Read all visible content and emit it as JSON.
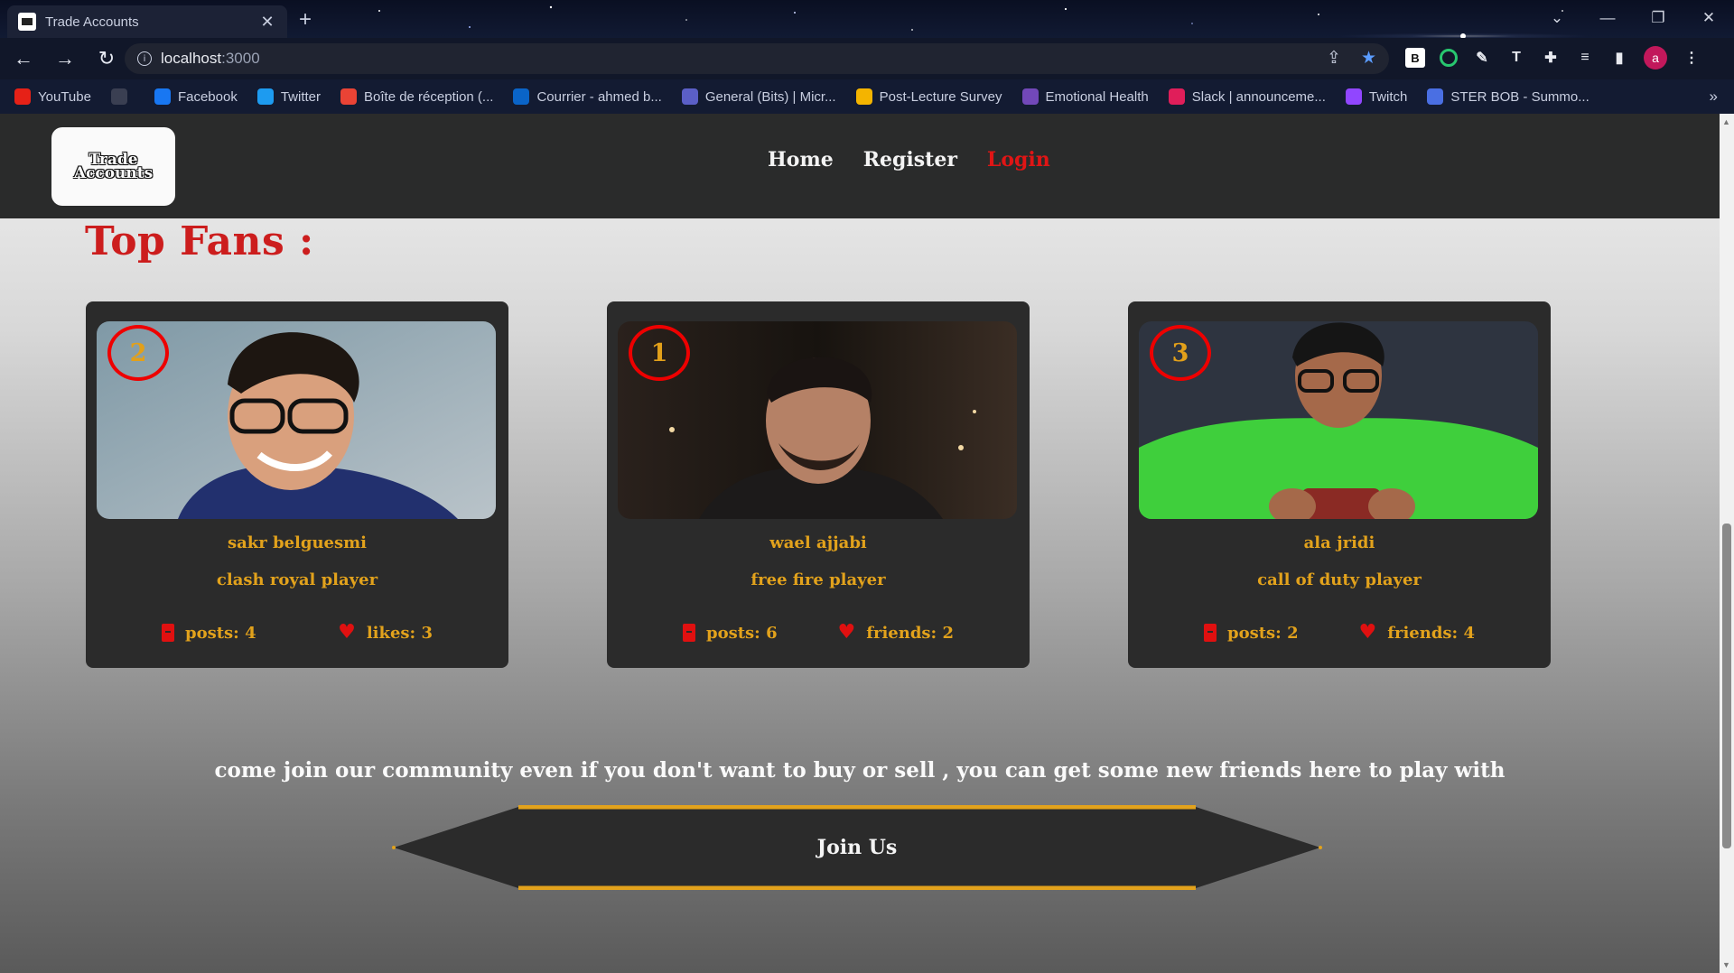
{
  "browser": {
    "tab_title": "Trade Accounts",
    "tab_close": "✕",
    "new_tab": "+",
    "url_host": "localhost",
    "url_port": ":3000",
    "window_controls": [
      "⌄",
      "—",
      "❐",
      "✕"
    ],
    "profile_initial": "a",
    "bookmarks": [
      {
        "label": "YouTube",
        "icon": "youtube-icon",
        "color": "#e62117"
      },
      {
        "label": "",
        "icon": "globe-icon",
        "color": "#3a3f52"
      },
      {
        "label": "Facebook",
        "icon": "facebook-icon",
        "color": "#1877f2"
      },
      {
        "label": "Twitter",
        "icon": "twitter-icon",
        "color": "#1d9bf0"
      },
      {
        "label": "Boîte de réception (...",
        "icon": "gmail-icon",
        "color": "#ea4335"
      },
      {
        "label": "Courrier - ahmed b...",
        "icon": "outlook-icon",
        "color": "#0a64c8"
      },
      {
        "label": "General (Bits) | Micr...",
        "icon": "teams-icon",
        "color": "#5b5fc7"
      },
      {
        "label": "Post-Lecture Survey",
        "icon": "drive-icon",
        "color": "#f4b400"
      },
      {
        "label": "Emotional Health",
        "icon": "forms-icon",
        "color": "#7248b9"
      },
      {
        "label": "Slack | announceme...",
        "icon": "slack-icon",
        "color": "#e01e5a"
      },
      {
        "label": "Twitch",
        "icon": "twitch-icon",
        "color": "#9146ff"
      },
      {
        "label": "STER BOB - Summo...",
        "icon": "ster-icon",
        "color": "#4a6fe3"
      }
    ],
    "bookmarks_more": "»"
  },
  "site": {
    "logo_text": "Trade Accounts",
    "nav": [
      {
        "label": "Home",
        "active": false
      },
      {
        "label": "Register",
        "active": false
      },
      {
        "label": "Login",
        "active": true
      }
    ],
    "section_title": "Top Fans :",
    "cards": [
      {
        "rank": "2",
        "name": "sakr belguesmi",
        "game": "clash royal player",
        "posts": "posts: 4",
        "second_stat": "likes: 3"
      },
      {
        "rank": "1",
        "name": "wael ajjabi",
        "game": "free fire player",
        "posts": "posts: 6",
        "second_stat": "friends: 2"
      },
      {
        "rank": "3",
        "name": "ala jridi",
        "game": "call of duty player",
        "posts": "posts: 2",
        "second_stat": "friends: 4"
      }
    ],
    "community_text": "come join our community even if you don't want to buy or sell , you can get some new friends here to play with",
    "join_button": "Join Us"
  },
  "colors": {
    "accent_red": "#cc1d1d",
    "gold": "#e2a21c",
    "nav_bg": "#2a2b2b"
  }
}
